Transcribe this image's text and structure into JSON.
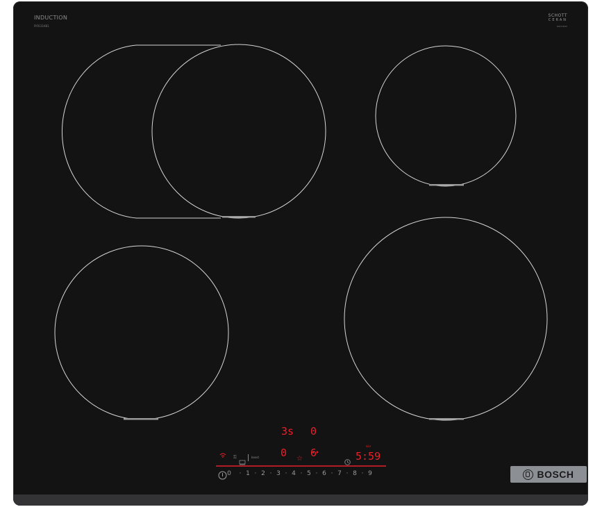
{
  "brand": {
    "induction_label": "INDUCTION",
    "model_code": "PIF631HB1",
    "glass_brand_line1": "SCHOTT",
    "glass_brand_line2": "CERAN",
    "glass_code": "NSH74MV",
    "maker": "BOSCH"
  },
  "colors": {
    "glass": "#131313",
    "zone_outline": "#d9d9d9",
    "display_red": "#e8202a",
    "badge": "#8c8f94"
  },
  "displays": {
    "zone_top_left_level": "3s",
    "zone_top_right_level": "0",
    "zone_bottom_left_level": "0",
    "zone_bottom_right_level": "6",
    "timer_label": "min",
    "timer_value": "5:59"
  },
  "controls": {
    "power_icon": "power-icon",
    "wifi_icon": "wifi-icon",
    "lock_label": "⚿",
    "favorite_icon": "star-icon",
    "timer_icon": "clock-icon",
    "boost_label": "boost"
  },
  "power_scale": [
    "0",
    "·",
    "1",
    "·",
    "2",
    "·",
    "3",
    "·",
    "4",
    "·",
    "5",
    "·",
    "6",
    "·",
    "7",
    "·",
    "8",
    "·",
    "9"
  ]
}
